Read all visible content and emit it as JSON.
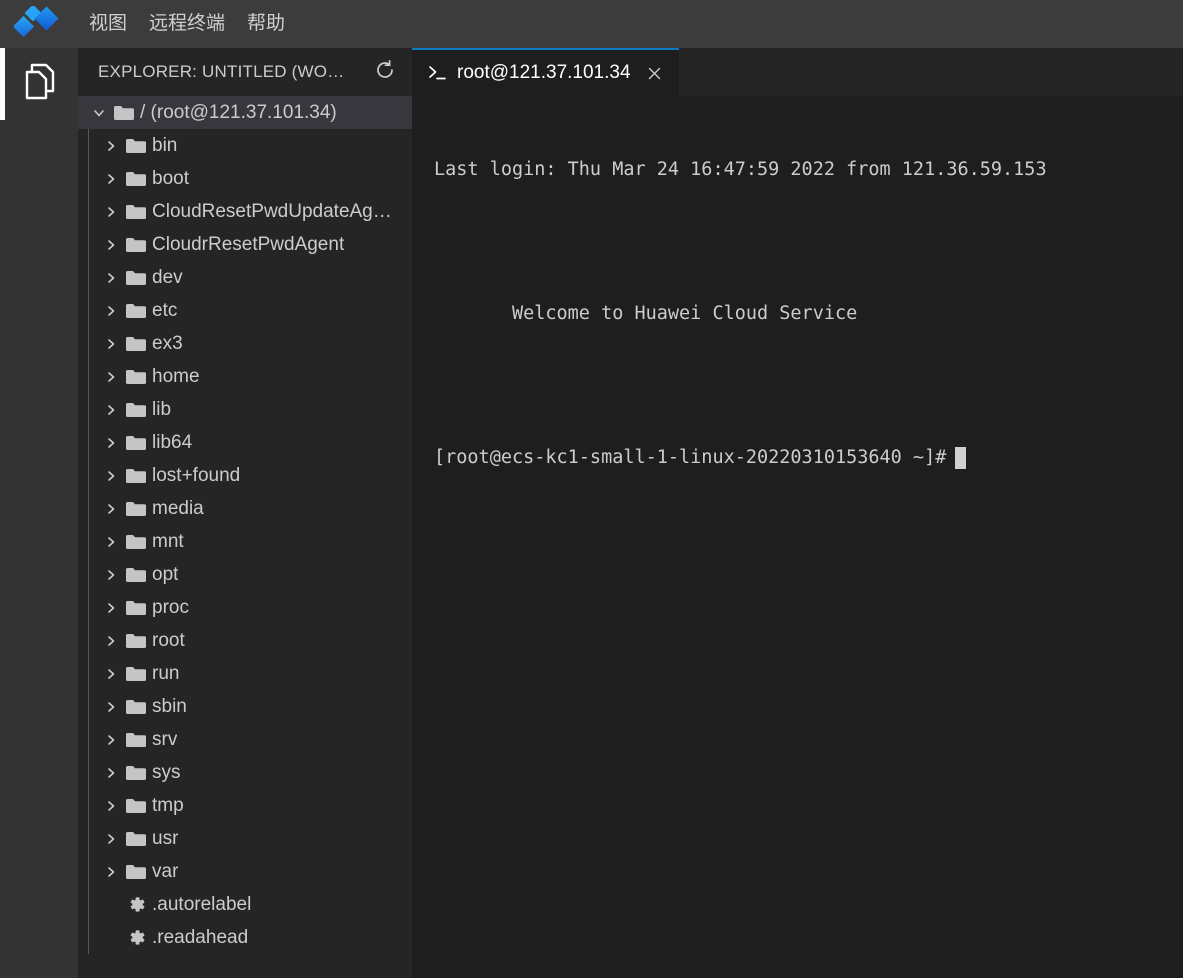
{
  "titlebar": {
    "logo_icon": "diamond-logo-icon",
    "menus": [
      {
        "label": "视图",
        "name": "menu-view"
      },
      {
        "label": "远程终端",
        "name": "menu-remote-terminal"
      },
      {
        "label": "帮助",
        "name": "menu-help"
      }
    ]
  },
  "activitybar": {
    "items": [
      {
        "icon": "files-explorer-icon",
        "active": true
      }
    ]
  },
  "sidebar": {
    "header": {
      "title": "EXPLORER: UNTITLED (WO…",
      "refresh_icon": "refresh-icon"
    },
    "tree": {
      "root": {
        "label": "/ (root@121.37.101.34)",
        "expanded": true,
        "icon": "folder-icon",
        "twisty": "chevron-down-icon"
      },
      "items": [
        {
          "label": "bin",
          "type": "folder"
        },
        {
          "label": "boot",
          "type": "folder"
        },
        {
          "label": "CloudResetPwdUpdateAg…",
          "type": "folder"
        },
        {
          "label": "CloudrResetPwdAgent",
          "type": "folder"
        },
        {
          "label": "dev",
          "type": "folder"
        },
        {
          "label": "etc",
          "type": "folder"
        },
        {
          "label": "ex3",
          "type": "folder"
        },
        {
          "label": "home",
          "type": "folder"
        },
        {
          "label": "lib",
          "type": "folder"
        },
        {
          "label": "lib64",
          "type": "folder"
        },
        {
          "label": "lost+found",
          "type": "folder"
        },
        {
          "label": "media",
          "type": "folder"
        },
        {
          "label": "mnt",
          "type": "folder"
        },
        {
          "label": "opt",
          "type": "folder"
        },
        {
          "label": "proc",
          "type": "folder"
        },
        {
          "label": "root",
          "type": "folder"
        },
        {
          "label": "run",
          "type": "folder"
        },
        {
          "label": "sbin",
          "type": "folder"
        },
        {
          "label": "srv",
          "type": "folder"
        },
        {
          "label": "sys",
          "type": "folder"
        },
        {
          "label": "tmp",
          "type": "folder"
        },
        {
          "label": "usr",
          "type": "folder"
        },
        {
          "label": "var",
          "type": "folder"
        },
        {
          "label": ".autorelabel",
          "type": "file-gear"
        },
        {
          "label": ".readahead",
          "type": "file-gear"
        }
      ]
    }
  },
  "editor": {
    "tabs": [
      {
        "label": "root@121.37.101.34",
        "icon": "terminal-prompt-icon",
        "close_icon": "close-icon",
        "active": true
      }
    ],
    "terminal": {
      "lines": [
        "Last login: Thu Mar 24 16:47:59 2022 from 121.36.59.153",
        "",
        "       Welcome to Huawei Cloud Service",
        ""
      ],
      "prompt": "[root@ecs-kc1-small-1-linux-20220310153640 ~]#",
      "cursor": "block-cursor"
    }
  },
  "colors": {
    "titlebar_bg": "#3c3c3c",
    "activitybar_bg": "#333333",
    "sidebar_bg": "#252526",
    "terminal_bg": "#1e1e1e",
    "tab_active_border": "#0a7bc4",
    "selection_bg": "#37373d",
    "text": "#cccccc",
    "logo_blue": "#1e90ff"
  }
}
